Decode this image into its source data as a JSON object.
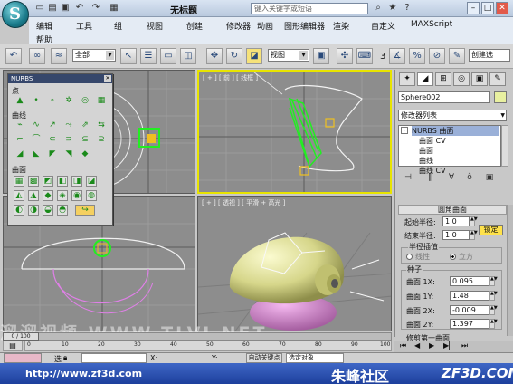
{
  "titlebar": {
    "title": "无标题",
    "search_placeholder": "键入关键字或短语"
  },
  "menus": {
    "row1": [
      "编辑",
      "工具",
      "组",
      "视图",
      "创建",
      "修改器",
      "动画",
      "图形编辑器",
      "渲染",
      "自定义",
      "MAXScript"
    ],
    "row2": [
      "帮助"
    ]
  },
  "toolbar": {
    "selection_filter": "全部",
    "ref_coord": "视图",
    "snap_value": "3",
    "named_selection": "创建选"
  },
  "viewports": {
    "top_right_label": "[ + ] [ 前 ] [ 线框 ]",
    "bottom_right_label": "[ + ] [ 透视 ] [ 平滑 + 高光 ]"
  },
  "nurbs_toolbox": {
    "title": "NURBS",
    "section_point": "点",
    "section_curve": "曲线",
    "section_surface": "曲面"
  },
  "command_panel": {
    "object_name": "Sphere002",
    "modifier_list": "修改器列表",
    "stack": {
      "root": "NURBS 曲面",
      "items": [
        "曲面 CV",
        "曲面",
        "曲线",
        "曲线 CV"
      ]
    },
    "rollout_fillet": {
      "title": "圆角曲面",
      "start_radius_label": "起始半径:",
      "start_radius": "1.0",
      "end_radius_label": "结束半径:",
      "end_radius": "1.0",
      "lock_label": "锁定",
      "interp_group": "半径插值",
      "interp_linear": "线性",
      "interp_cubic": "立方"
    },
    "rollout_seed": {
      "title": "种子",
      "surface1x_label": "曲面 1X:",
      "surface1x": "0.095",
      "surface1y_label": "曲面 1Y:",
      "surface1y": "1.48",
      "surface2x_label": "曲面 2X:",
      "surface2x": "-0.009",
      "surface2y_label": "曲面 2Y:",
      "surface2y": "1.397"
    },
    "trim_label": "修剪第一曲面"
  },
  "timeline": {
    "frame_readout": "0 / 100",
    "ticks": [
      "0",
      "10",
      "20",
      "30",
      "40",
      "50",
      "60",
      "70",
      "80",
      "90",
      "100"
    ]
  },
  "statusbar": {
    "select_label": "选",
    "x_label": "X:",
    "y_label": "Y:",
    "autokey": "自动关键点",
    "selected_object": "选定对象"
  },
  "footer": {
    "url": "http://www.zf3d.com",
    "brand_cn": "朱峰社区",
    "brand_en": "ZF3D.COM",
    "watermark": "溜溜视频 WWW.TLVI.NET"
  }
}
